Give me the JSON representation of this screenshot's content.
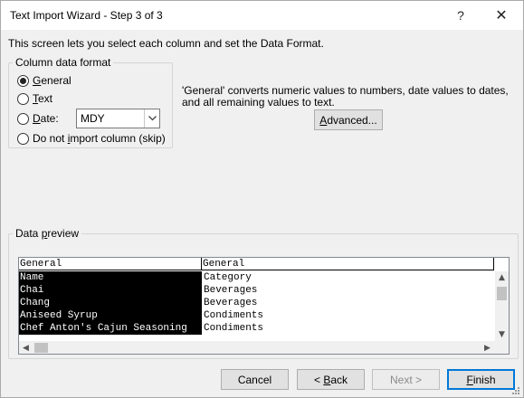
{
  "window": {
    "title": "Text Import Wizard - Step 3 of 3",
    "help_label": "?",
    "close_label": "✕"
  },
  "intro_text": "This screen lets you select each column and set the Data Format.",
  "column_data_format": {
    "legend": "Column data format",
    "options": {
      "general": {
        "label_key": "G",
        "label_rest": "eneral",
        "checked": true
      },
      "text": {
        "label_key": "T",
        "label_rest": "ext",
        "checked": false
      },
      "date": {
        "label_key": "D",
        "label_rest": "ate:",
        "checked": false
      },
      "skip": {
        "label_pre": "Do not ",
        "label_key": "i",
        "label_rest": "mport column (skip)",
        "checked": false
      }
    },
    "date_format": {
      "value": "MDY"
    }
  },
  "description": "'General' converts numeric values to numbers, date values to dates, and all remaining values to text.",
  "advanced_button": {
    "label_key": "A",
    "label_rest": "dvanced..."
  },
  "data_preview": {
    "legend_pre": "Data ",
    "legend_key": "p",
    "legend_rest": "review",
    "column_formats": [
      "General",
      "General"
    ],
    "rows": [
      [
        "Name",
        "Category"
      ],
      [
        "Chai",
        "Beverages"
      ],
      [
        "Chang",
        "Beverages"
      ],
      [
        "Aniseed Syrup",
        "Condiments"
      ],
      [
        "Chef Anton's Cajun Seasoning",
        "Condiments"
      ]
    ]
  },
  "buttons": {
    "cancel": "Cancel",
    "back": {
      "label_pre": "< ",
      "label_key": "B",
      "label_rest": "ack"
    },
    "next": "Next >",
    "finish": {
      "label_key": "F",
      "label_rest": "inish"
    }
  },
  "scroll_glyphs": {
    "up": "▲",
    "down": "▼",
    "left": "◀",
    "right": "▶"
  }
}
